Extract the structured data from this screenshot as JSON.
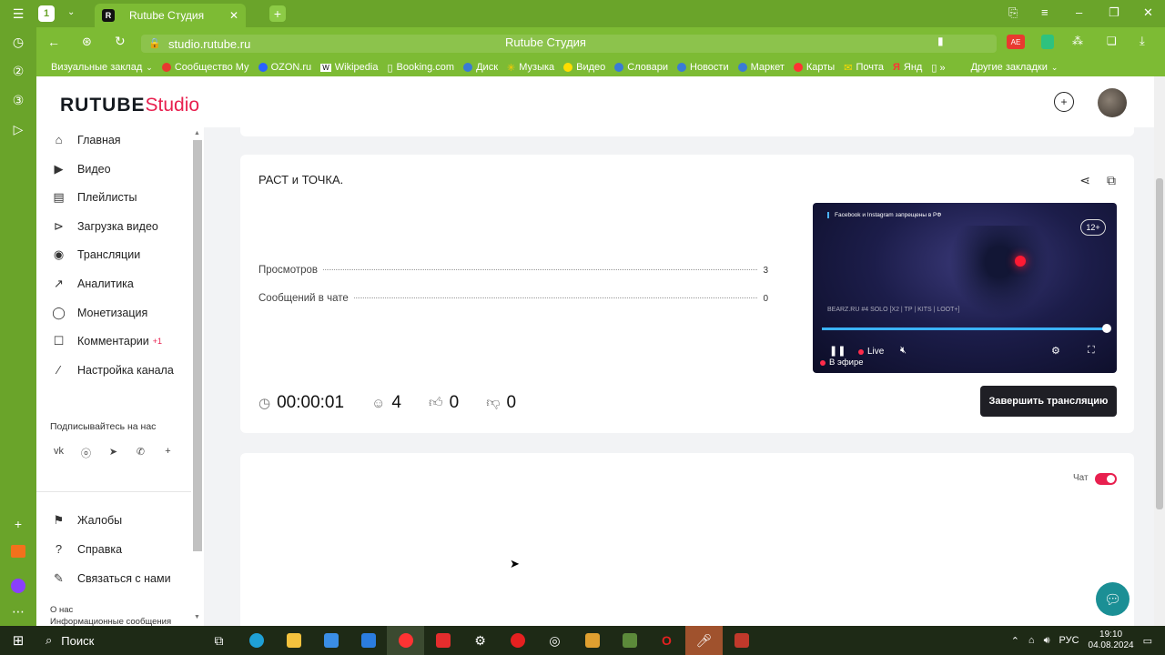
{
  "browser": {
    "tab_title": "Rutube Студия",
    "tab_favicon": "R",
    "tab_count_badge": "1",
    "url": "studio.rutube.ru",
    "page_title": "Rutube Студия",
    "bookmarks": [
      {
        "label": "Визуальные заклад",
        "icon": "bookmarks-icon",
        "color": "#ffffff"
      },
      {
        "label": "Сообщество Му",
        "icon": "red-circle",
        "color": "#e83a2f"
      },
      {
        "label": "OZON.ru",
        "icon": "ozon-logo",
        "color": "#2962ff"
      },
      {
        "label": "Wikipedia",
        "icon": "wiki-logo",
        "color": "#ffffff"
      },
      {
        "label": "Booking.com",
        "icon": "page-icon",
        "color": "#ffffff"
      },
      {
        "label": "Диск",
        "icon": "disk-icon",
        "color": "#3a7bd5"
      },
      {
        "label": "Музыка",
        "icon": "music-icon",
        "color": "#ffcc00"
      },
      {
        "label": "Видео",
        "icon": "video-icon",
        "color": "#ffdd00"
      },
      {
        "label": "Словари",
        "icon": "dict-icon",
        "color": "#3a7bd5"
      },
      {
        "label": "Новости",
        "icon": "news-icon",
        "color": "#3a7bd5"
      },
      {
        "label": "Маркет",
        "icon": "market-icon",
        "color": "#3a7bd5"
      },
      {
        "label": "Карты",
        "icon": "maps-icon",
        "color": "#ff3333"
      },
      {
        "label": "Почта",
        "icon": "mail-icon",
        "color": "#ff3333"
      },
      {
        "label": "Янд",
        "icon": "yandex-icon",
        "color": "#ff3333"
      }
    ],
    "other_bookmarks": "Другие закладки"
  },
  "header": {
    "logo_main": "RUTUBE",
    "logo_sub": "Studio"
  },
  "sidebar": {
    "items": [
      {
        "label": "Главная",
        "icon": "home-icon"
      },
      {
        "label": "Видео",
        "icon": "video-icon"
      },
      {
        "label": "Плейлисты",
        "icon": "playlist-icon"
      },
      {
        "label": "Загрузка видео",
        "icon": "upload-icon"
      },
      {
        "label": "Трансляции",
        "icon": "broadcast-icon"
      },
      {
        "label": "Аналитика",
        "icon": "analytics-icon"
      },
      {
        "label": "Монетизация",
        "icon": "monetization-icon"
      },
      {
        "label": "Комментарии",
        "icon": "comments-icon",
        "badge": "+1"
      },
      {
        "label": "Настройка канала",
        "icon": "wand-icon"
      }
    ],
    "subscribe_title": "Подписывайтесь на нас",
    "socials": [
      "vk-icon",
      "ok-icon",
      "telegram-icon",
      "viber-icon",
      "plus-icon"
    ],
    "footer_items": [
      {
        "label": "Жалобы",
        "icon": "flag-icon"
      },
      {
        "label": "Справка",
        "icon": "help-icon"
      },
      {
        "label": "Связаться с нами",
        "icon": "pen-icon"
      }
    ],
    "small_links": [
      "О нас",
      "Информационные сообщения"
    ]
  },
  "stream": {
    "title": "РАСТ и ТОЧКА.",
    "stats": [
      {
        "label": "Просмотров",
        "value": "3"
      },
      {
        "label": "Сообщений в чате",
        "value": "0"
      }
    ],
    "duration": "00:00:01",
    "viewers": "4",
    "likes": "0",
    "dislikes": "0",
    "end_button": "Завершить трансляцию"
  },
  "player": {
    "banner": "Facebook и Instagram запрещены в РФ",
    "age_rating": "12+",
    "game_text": "BEARZ.RU #4 SOLO [X2 | TP | KITS | LOOT+]",
    "live_label": "Live",
    "on_air_label": "В эфире",
    "progress": 1.0
  },
  "chat": {
    "label": "Чат",
    "enabled": true
  },
  "taskbar": {
    "search_label": "Поиск",
    "language": "РУС",
    "time": "19:10",
    "date": "04.08.2024"
  },
  "colors": {
    "accent": "#e8204f",
    "browser_theme": "#6aa42a",
    "help_button": "#1b8f95"
  }
}
